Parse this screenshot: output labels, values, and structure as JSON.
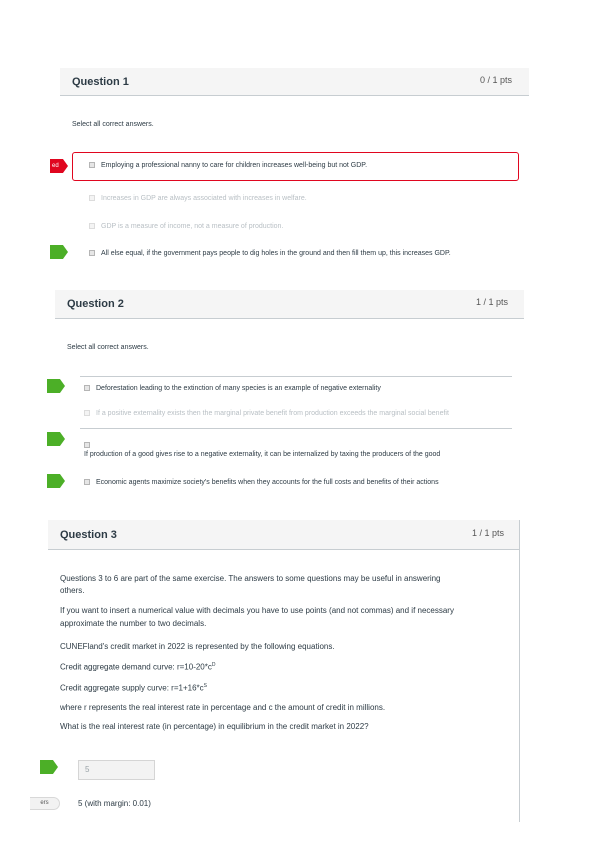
{
  "q1": {
    "title": "Question 1",
    "points": "0 / 1 pts",
    "instruction": "Select all correct answers.",
    "flag_label": "ed",
    "answers": [
      "Employing a professional nanny to care for children increases well-being but not GDP.",
      "Increases in GDP are always associated with increases in welfare.",
      "GDP is a measure of income, not a measure of production.",
      "All else equal, if the government pays people to dig holes in the ground and then fill them up, this increases GDP."
    ]
  },
  "q2": {
    "title": "Question 2",
    "points": "1 / 1 pts",
    "instruction": "Select all correct answers.",
    "answers": [
      "Deforestation leading to the extinction of many species is an example of negative externality",
      "If a positive externality exists then the marginal private benefit from production exceeds the marginal social benefit",
      "If production of a good gives rise to a negative externality, it can be internalized by taxing the producers of the good",
      "Economic agents maximize society's benefits when they accounts for the full costs and benefits of their actions"
    ]
  },
  "q3": {
    "title": "Question 3",
    "points": "1 / 1 pts",
    "intro_line1": "Questions 3 to 6 are part of the same exercise. The answers to some questions may be useful in answering",
    "intro_line2": "others.",
    "decimals_line1": "If you want to insert a numerical value with decimals you have to use points (and not commas) and if necessary",
    "decimals_line2": "approximate the number to two decimals.",
    "market": "CUNEFland's credit market in 2022 is represented by the following equations.",
    "demand_label": "Credit aggregate demand curve: r=10-20*c",
    "demand_sup": "D",
    "supply_label": "Credit aggregate supply curve: r=1+16*c",
    "supply_sup": "S",
    "where": "where r represents the real interest rate in percentage and c the amount of credit in millions.",
    "question": "What is the real interest rate (in percentage) in equilibrium in the credit market in 2022?",
    "answer_value": "5",
    "other_answers_tag": "ers",
    "correct_answer": "5 (with margin: 0.01)"
  }
}
